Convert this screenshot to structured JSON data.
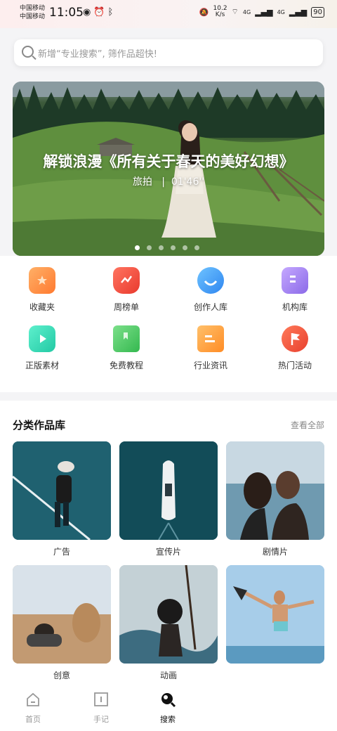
{
  "status_bar": {
    "carrier_1": "中国移动",
    "carrier_2": "中国移动",
    "time": "11:05",
    "speed_value": "10.2",
    "speed_unit": "K/s",
    "signal_1": "4G",
    "signal_2": "4G",
    "battery": "90"
  },
  "search": {
    "placeholder": "新增“专业搜索”, 筛作品超快!"
  },
  "banner": {
    "title": "解锁浪漫《所有关于春天的美好幻想》",
    "category": "旅拍",
    "separator": "|",
    "duration": "01'46''",
    "page_count": 6,
    "active_page": 1
  },
  "quick_entries": [
    {
      "label": "收藏夹",
      "icon": "folder-icon",
      "color": "#ff8a3d"
    },
    {
      "label": "周榜单",
      "icon": "trophy-icon",
      "color": "#f2483a"
    },
    {
      "label": "创作人库",
      "icon": "creator-icon",
      "color": "#3a9cf5"
    },
    {
      "label": "机构库",
      "icon": "building-icon",
      "color": "#9a78f0"
    },
    {
      "label": "正版素材",
      "icon": "play-clip-icon",
      "color": "#2fd3b0"
    },
    {
      "label": "免费教程",
      "icon": "book-icon",
      "color": "#3fc45a"
    },
    {
      "label": "行业资讯",
      "icon": "news-icon",
      "color": "#ff9d2e"
    },
    {
      "label": "热门活动",
      "icon": "flag-icon",
      "color": "#f0503a"
    }
  ],
  "category_section": {
    "title": "分类作品库",
    "more_label": "查看全部",
    "items": [
      {
        "label": "广告"
      },
      {
        "label": "宣传片"
      },
      {
        "label": "剧情片"
      },
      {
        "label": "创意"
      },
      {
        "label": "动画"
      },
      {
        "label": ""
      }
    ]
  },
  "tab_bar": {
    "tabs": [
      {
        "label": "首页",
        "icon": "home-icon",
        "active": false
      },
      {
        "label": "手记",
        "icon": "notebook-icon",
        "active": false
      },
      {
        "label": "搜索",
        "icon": "search-icon",
        "active": true
      }
    ]
  }
}
